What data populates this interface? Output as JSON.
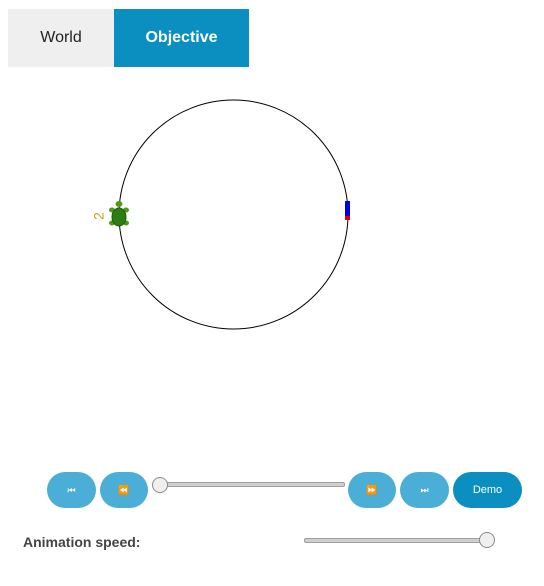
{
  "tabs": {
    "world": "World",
    "objective": "Objective"
  },
  "scene": {
    "turtle_label": "2",
    "target_colors": [
      "#0000dd",
      "#dd0000"
    ],
    "turtle_color": "#2e7d13"
  },
  "controls": {
    "first_icon": "⏮",
    "prev_icon": "⏪",
    "next_icon": "⏩",
    "last_icon": "⏭",
    "demo_label": "Demo",
    "step_progress": 0.0
  },
  "speed": {
    "label": "Animation speed:",
    "value": 1.0
  }
}
